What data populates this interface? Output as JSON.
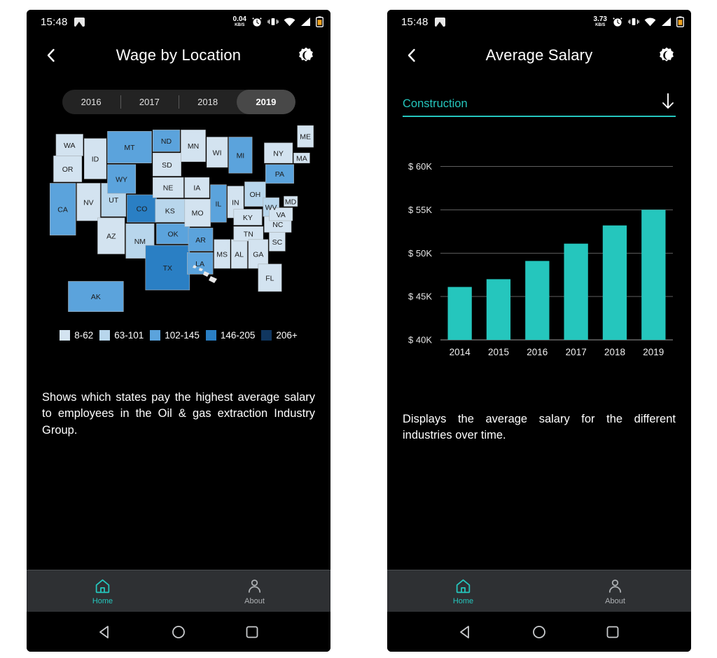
{
  "theme": {
    "accent": "#25c6bd",
    "bg": "#000000",
    "nav_bg": "#2e3033",
    "text": "#ffffff",
    "muted": "#adb0b3",
    "year_pill_bg": "#232323",
    "year_selected_bg": "#484848"
  },
  "left_phone": {
    "status_bar": {
      "time": "15:48",
      "net_speed_value": "0.04",
      "net_speed_unit": "KB/S",
      "icons": [
        "image-icon",
        "alarm-icon",
        "vibrate-icon",
        "wifi-icon",
        "signal-icon",
        "battery-icon"
      ]
    },
    "header": {
      "back_icon": "chevron-left-icon",
      "title": "Wage by Location",
      "theme_icon": "brightness-dark-mode-icon"
    },
    "year_selector": {
      "options": [
        "2016",
        "2017",
        "2018",
        "2019"
      ],
      "selected": "2019"
    },
    "map": {
      "legend": [
        {
          "label": "8-62",
          "color": "#d3e3f0"
        },
        {
          "label": "63-101",
          "color": "#b8d6ec"
        },
        {
          "label": "102-145",
          "color": "#5ba3dc"
        },
        {
          "label": "146-205",
          "color": "#2a7fc4"
        },
        {
          "label": "206+",
          "color": "#10365f"
        }
      ],
      "base_color": "#e8e8e8",
      "states": [
        {
          "abbr": "WA",
          "bin": 0
        },
        {
          "abbr": "OR",
          "bin": 0
        },
        {
          "abbr": "ID",
          "bin": 0
        },
        {
          "abbr": "MT",
          "bin": 2
        },
        {
          "abbr": "ND",
          "bin": 2
        },
        {
          "abbr": "MN",
          "bin": 0
        },
        {
          "abbr": "WI",
          "bin": 0
        },
        {
          "abbr": "MI",
          "bin": 2
        },
        {
          "abbr": "ME",
          "bin": 0
        },
        {
          "abbr": "SD",
          "bin": 0
        },
        {
          "abbr": "WY",
          "bin": 2
        },
        {
          "abbr": "NE",
          "bin": 0
        },
        {
          "abbr": "IA",
          "bin": 0
        },
        {
          "abbr": "NY",
          "bin": 0
        },
        {
          "abbr": "MA",
          "bin": 0
        },
        {
          "abbr": "NV",
          "bin": 0
        },
        {
          "abbr": "UT",
          "bin": 1
        },
        {
          "abbr": "CO",
          "bin": 3
        },
        {
          "abbr": "KS",
          "bin": 1
        },
        {
          "abbr": "MO",
          "bin": 0
        },
        {
          "abbr": "IL",
          "bin": 2
        },
        {
          "abbr": "IN",
          "bin": 0
        },
        {
          "abbr": "OH",
          "bin": 1
        },
        {
          "abbr": "PA",
          "bin": 2
        },
        {
          "abbr": "WV",
          "bin": 1
        },
        {
          "abbr": "VA",
          "bin": 0
        },
        {
          "abbr": "MD",
          "bin": 0
        },
        {
          "abbr": "CA",
          "bin": 2
        },
        {
          "abbr": "AZ",
          "bin": 0
        },
        {
          "abbr": "NM",
          "bin": 1
        },
        {
          "abbr": "OK",
          "bin": 2
        },
        {
          "abbr": "AR",
          "bin": 2
        },
        {
          "abbr": "TX",
          "bin": 3
        },
        {
          "abbr": "LA",
          "bin": 2
        },
        {
          "abbr": "MS",
          "bin": 0
        },
        {
          "abbr": "AL",
          "bin": 0
        },
        {
          "abbr": "GA",
          "bin": 0
        },
        {
          "abbr": "TN",
          "bin": 0
        },
        {
          "abbr": "KY",
          "bin": 0
        },
        {
          "abbr": "NC",
          "bin": 0
        },
        {
          "abbr": "SC",
          "bin": 0
        },
        {
          "abbr": "FL",
          "bin": 0
        },
        {
          "abbr": "AK",
          "bin": 2
        }
      ]
    },
    "description": "Shows which states pay the highest average salary to employees in the Oil & gas extraction Industry Group.",
    "bottom_nav": [
      {
        "label": "Home",
        "icon": "home-icon",
        "active": true
      },
      {
        "label": "About",
        "icon": "person-icon",
        "active": false
      }
    ],
    "system_nav": [
      "back-triangle-icon",
      "home-circle-icon",
      "recents-square-icon"
    ]
  },
  "right_phone": {
    "status_bar": {
      "time": "15:48",
      "net_speed_value": "3.73",
      "net_speed_unit": "KB/S",
      "icons": [
        "image-icon",
        "alarm-icon",
        "vibrate-icon",
        "wifi-icon",
        "signal-icon",
        "battery-icon"
      ]
    },
    "header": {
      "back_icon": "chevron-left-icon",
      "title": "Average Salary",
      "theme_icon": "brightness-dark-mode-icon"
    },
    "industry_dropdown": {
      "value": "Construction",
      "arrow_icon": "arrow-down-icon"
    },
    "description": "Displays the average salary for the different industries over time.",
    "bottom_nav": [
      {
        "label": "Home",
        "icon": "home-icon",
        "active": true
      },
      {
        "label": "About",
        "icon": "person-icon",
        "active": false
      }
    ],
    "system_nav": [
      "back-triangle-icon",
      "home-circle-icon",
      "recents-square-icon"
    ]
  },
  "chart_data": {
    "type": "bar",
    "title": "Average Salary",
    "categories": [
      "2014",
      "2015",
      "2016",
      "2017",
      "2018",
      "2019"
    ],
    "values": [
      46100,
      47000,
      49100,
      51100,
      53200,
      55000
    ],
    "ytick_labels": [
      "$ 60K",
      "$ 55K",
      "$ 50K",
      "$ 45K",
      "$ 40K"
    ],
    "ytick_values": [
      60000,
      55000,
      50000,
      45000,
      40000
    ],
    "ylim": [
      40000,
      61500
    ],
    "xlabel": "",
    "ylabel": "",
    "grid": true,
    "legend": "none",
    "bar_color": "#25c6bd",
    "series_name": "Construction"
  }
}
